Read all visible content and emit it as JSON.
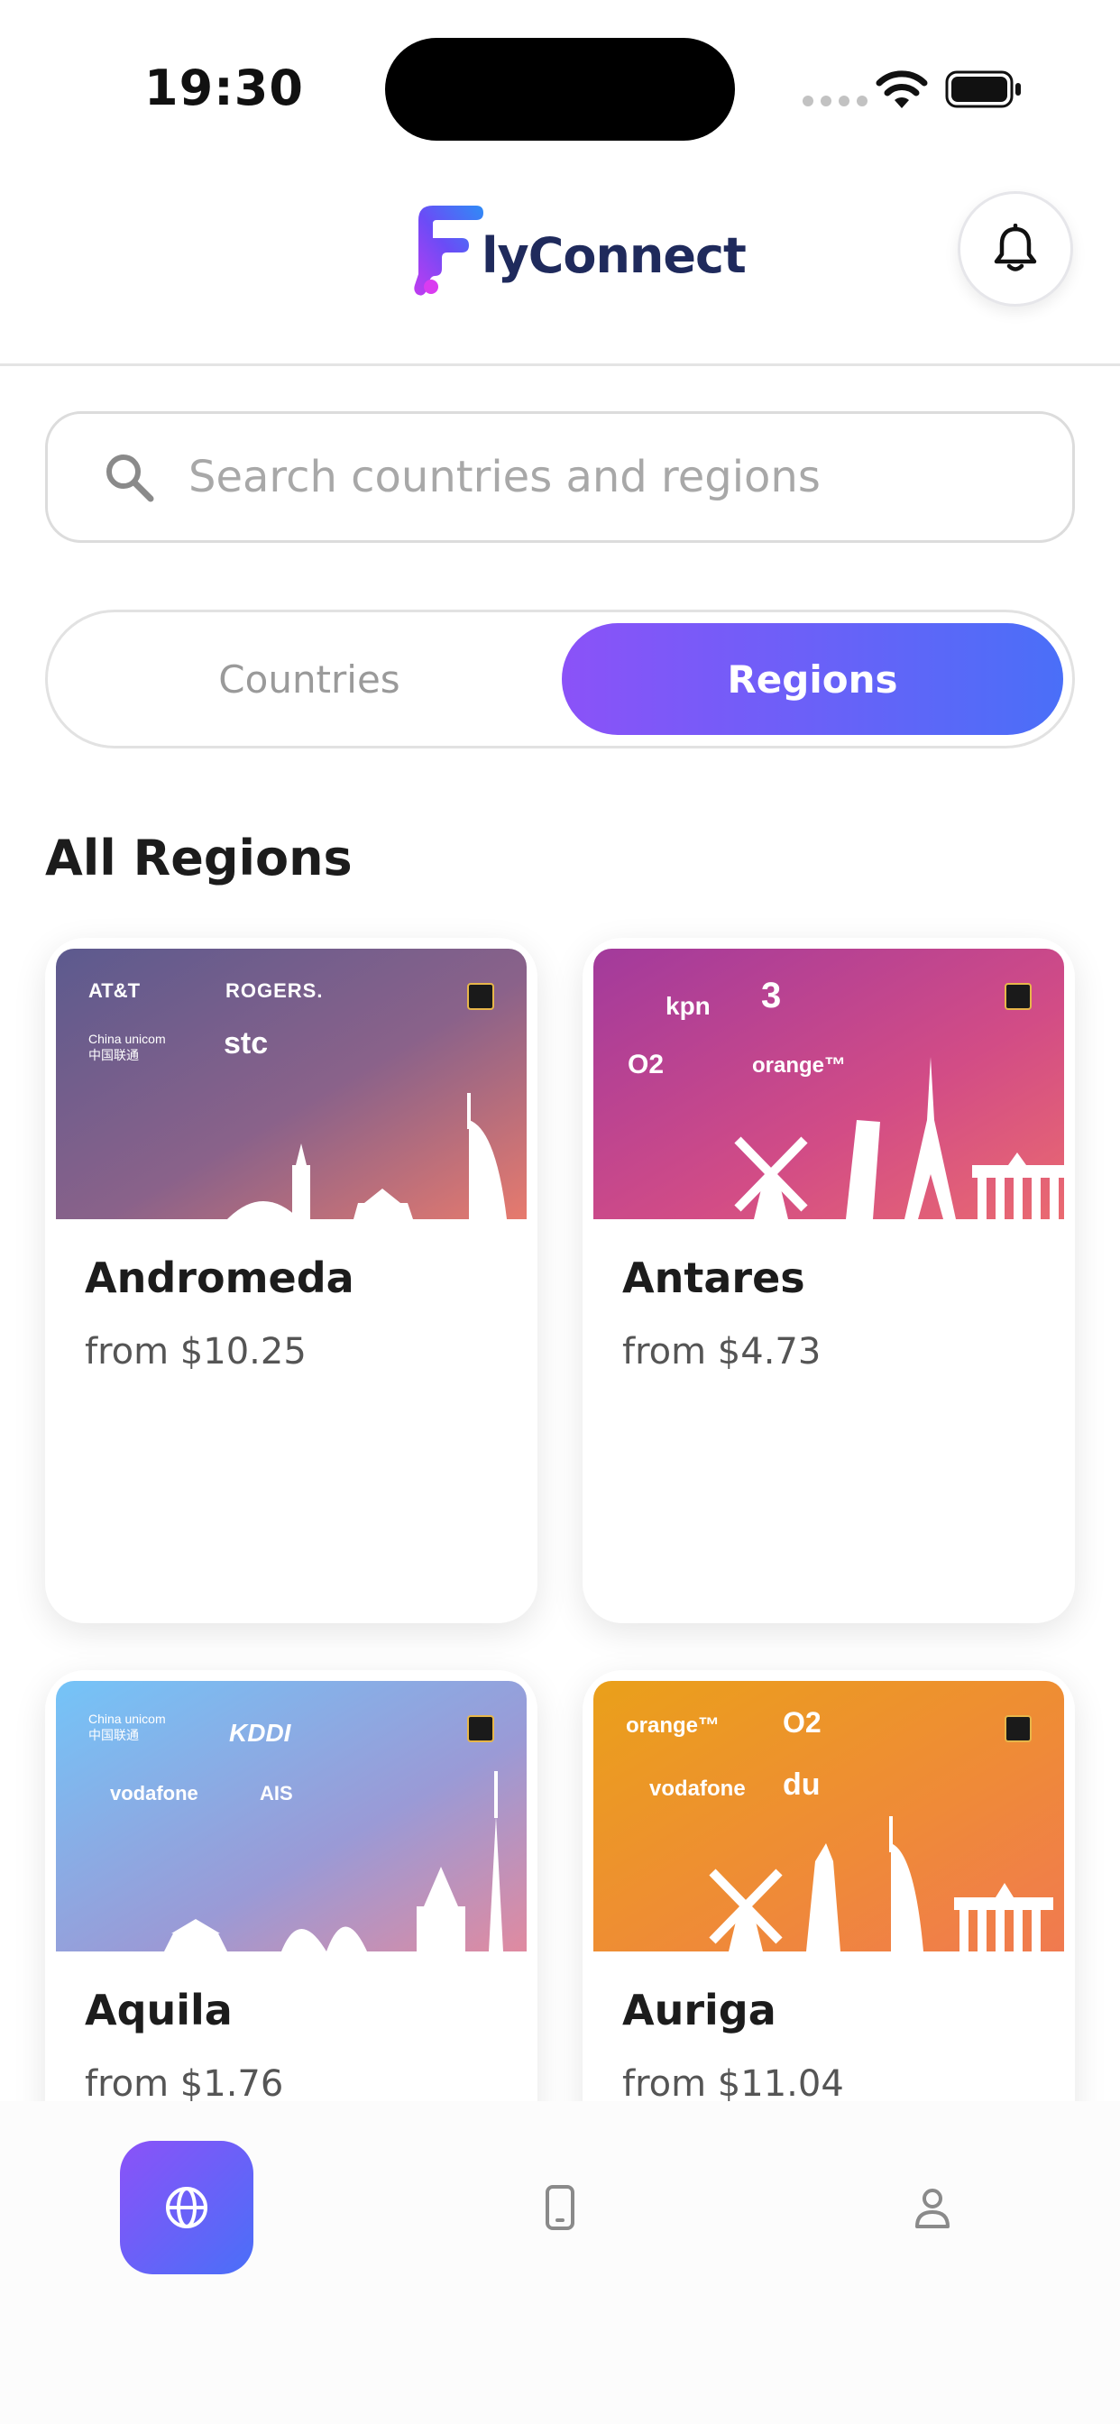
{
  "status_bar": {
    "time": "19:30"
  },
  "header": {
    "logo_text": "lyConnect",
    "logo_letter": "F"
  },
  "search": {
    "placeholder": "Search countries and regions",
    "value": ""
  },
  "tabs": [
    {
      "label": "Countries",
      "active": false
    },
    {
      "label": "Regions",
      "active": true
    }
  ],
  "section": {
    "title": "All Regions"
  },
  "regions": [
    {
      "name": "Andromeda",
      "price": "from $10.25",
      "carriers": [
        "AT&T",
        "ROGERS.",
        "China unicom中国联通",
        "stc"
      ]
    },
    {
      "name": "Antares",
      "price": "from $4.73",
      "carriers": [
        "kpn",
        "3",
        "O2",
        "orange™"
      ]
    },
    {
      "name": "Aquila",
      "price": "from $1.76",
      "carriers": [
        "China unicom中国联通",
        "KDDI",
        "vodafone",
        "AIS"
      ]
    },
    {
      "name": "Auriga",
      "price": "from $11.04",
      "carriers": [
        "orange™",
        "O2",
        "vodafone",
        "du"
      ]
    }
  ],
  "esim_badge": "eSIM",
  "nav": [
    {
      "name": "globe-icon",
      "active": true
    },
    {
      "name": "phone-icon",
      "active": false
    },
    {
      "name": "user-icon",
      "active": false
    }
  ],
  "colors": {
    "accent_start": "#8b52f8",
    "accent_end": "#4a6ff8",
    "brand_text": "#1f2a5c"
  }
}
